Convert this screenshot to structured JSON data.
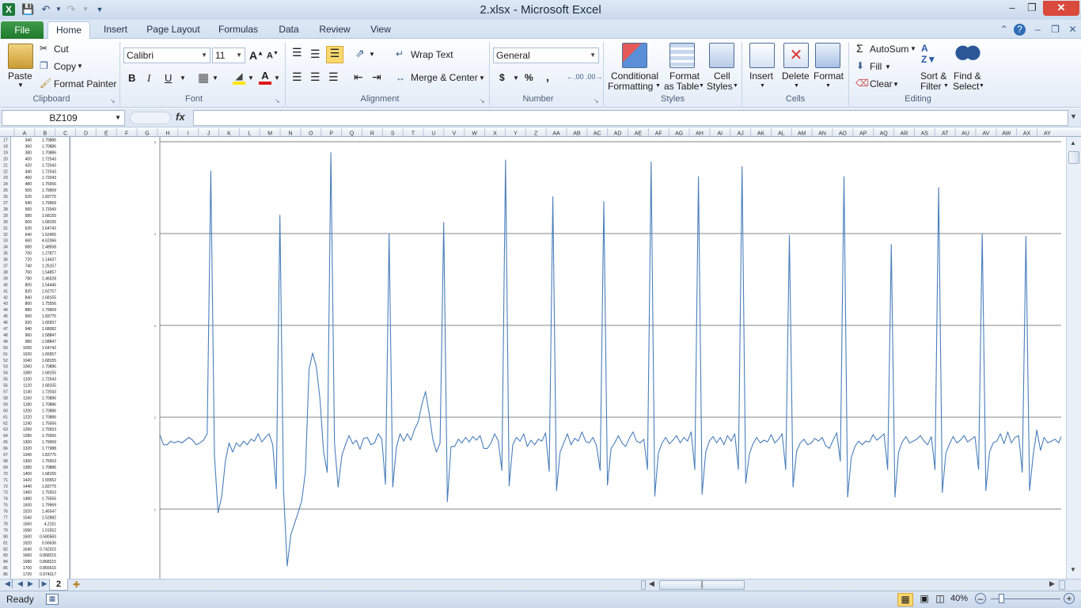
{
  "title_bar": {
    "title": "2.xlsx - Microsoft Excel"
  },
  "tabs": [
    "File",
    "Home",
    "Insert",
    "Page Layout",
    "Formulas",
    "Data",
    "Review",
    "View"
  ],
  "active_tab": "Home",
  "ribbon": {
    "clipboard": {
      "label": "Clipboard",
      "paste": "Paste",
      "cut": "Cut",
      "copy": "Copy",
      "format_painter": "Format Painter"
    },
    "font": {
      "label": "Font",
      "name": "Calibri",
      "size": "11"
    },
    "alignment": {
      "label": "Alignment",
      "wrap": "Wrap Text",
      "merge": "Merge & Center"
    },
    "number": {
      "label": "Number",
      "format": "General"
    },
    "styles": {
      "label": "Styles",
      "cond_1": "Conditional",
      "cond_2": "Formatting",
      "table_1": "Format",
      "table_2": "as Table",
      "cell_1": "Cell",
      "cell_2": "Styles"
    },
    "cells": {
      "label": "Cells",
      "insert": "Insert",
      "delete": "Delete",
      "format": "Format"
    },
    "editing": {
      "label": "Editing",
      "autosum": "AutoSum",
      "fill": "Fill",
      "clear": "Clear",
      "sort_1": "Sort &",
      "sort_2": "Filter",
      "find_1": "Find &",
      "find_2": "Select"
    }
  },
  "formula_bar": {
    "name_box": "BZ109",
    "fx": "fx",
    "formula": ""
  },
  "columns": [
    "A",
    "B",
    "C",
    "D",
    "E",
    "F",
    "G",
    "H",
    "I",
    "J",
    "K",
    "L",
    "M",
    "N",
    "O",
    "P",
    "Q",
    "R",
    "S",
    "T",
    "U",
    "V",
    "W",
    "X",
    "Y",
    "Z",
    "AA",
    "AB",
    "AC",
    "AD",
    "AE",
    "AF",
    "AG",
    "AH",
    "AI",
    "AJ",
    "AK",
    "AL",
    "AM",
    "AN",
    "AO",
    "AP",
    "AQ",
    "AR",
    "AS",
    "AT",
    "AU",
    "AV",
    "AW",
    "AX",
    "AY"
  ],
  "rows": [
    [
      "17",
      "340",
      "1.70886"
    ],
    [
      "18",
      "360",
      "1.70886"
    ],
    [
      "19",
      "380",
      "1.70886"
    ],
    [
      "20",
      "400",
      "1.72043"
    ],
    [
      "21",
      "420",
      "1.72043"
    ],
    [
      "22",
      "440",
      "1.72043"
    ],
    [
      "23",
      "460",
      "1.72043"
    ],
    [
      "24",
      "480",
      "1.75556"
    ],
    [
      "25",
      "500",
      "1.79969"
    ],
    [
      "26",
      "520",
      "1.83775"
    ],
    [
      "27",
      "540",
      "1.79969"
    ],
    [
      "28",
      "560",
      "1.72043"
    ],
    [
      "29",
      "580",
      "1.68155"
    ],
    [
      "30",
      "600",
      "1.68155"
    ],
    [
      "31",
      "620",
      "1.64742"
    ],
    [
      "32",
      "640",
      "1.52455"
    ],
    [
      "33",
      "660",
      "4.62366"
    ],
    [
      "34",
      "680",
      "2.48558"
    ],
    [
      "35",
      "700",
      "1.27877"
    ],
    [
      "36",
      "720",
      "1.14437"
    ],
    [
      "37",
      "740",
      "1.25157"
    ],
    [
      "38",
      "760",
      "1.54857"
    ],
    [
      "39",
      "780",
      "1.46528"
    ],
    [
      "40",
      "800",
      "1.54446"
    ],
    [
      "41",
      "820",
      "1.62757"
    ],
    [
      "42",
      "840",
      "1.68155"
    ],
    [
      "43",
      "860",
      "1.75556"
    ],
    [
      "44",
      "880",
      "1.79969"
    ],
    [
      "45",
      "900",
      "1.83775"
    ],
    [
      "46",
      "920",
      "1.65557"
    ],
    [
      "47",
      "940",
      "1.68082"
    ],
    [
      "48",
      "960",
      "1.58847"
    ],
    [
      "49",
      "980",
      "1.58847"
    ],
    [
      "50",
      "1000",
      "1.64742"
    ],
    [
      "51",
      "1020",
      "1.65557"
    ],
    [
      "52",
      "1040",
      "1.68155"
    ],
    [
      "53",
      "1060",
      "1.70886"
    ],
    [
      "54",
      "1080",
      "1.68155"
    ],
    [
      "55",
      "1100",
      "1.72043"
    ],
    [
      "56",
      "1120",
      "1.68155"
    ],
    [
      "57",
      "1140",
      "1.72043"
    ],
    [
      "58",
      "1160",
      "1.70886"
    ],
    [
      "59",
      "1180",
      "1.70886"
    ],
    [
      "60",
      "1200",
      "1.70886"
    ],
    [
      "61",
      "1220",
      "1.70886"
    ],
    [
      "62",
      "1240",
      "1.75556"
    ],
    [
      "63",
      "1260",
      "1.75553"
    ],
    [
      "64",
      "1280",
      "1.75556"
    ],
    [
      "65",
      "1300",
      "1.79969"
    ],
    [
      "66",
      "1320",
      "1.77988"
    ],
    [
      "67",
      "1340",
      "1.83775"
    ],
    [
      "68",
      "1360",
      "1.75553"
    ],
    [
      "69",
      "1380",
      "1.70886"
    ],
    [
      "70",
      "1400",
      "1.68155"
    ],
    [
      "71",
      "1420",
      "1.55552"
    ],
    [
      "72",
      "1440",
      "1.83775"
    ],
    [
      "73",
      "1460",
      "1.75553"
    ],
    [
      "74",
      "1480",
      "1.75556"
    ],
    [
      "75",
      "1500",
      "1.79969"
    ],
    [
      "76",
      "1520",
      "1.45547"
    ],
    [
      "77",
      "1540",
      "1.52882"
    ],
    [
      "78",
      "1560",
      "4.2151"
    ],
    [
      "79",
      "1580",
      "1.01552"
    ],
    [
      "80",
      "1600",
      "0.580583"
    ],
    [
      "81",
      "1620",
      "0.56636"
    ],
    [
      "82",
      "1640",
      "0.742315"
    ],
    [
      "83",
      "1660",
      "0.868215"
    ],
    [
      "84",
      "1680",
      "0.868215"
    ],
    [
      "85",
      "1700",
      "0.855516"
    ],
    [
      "86",
      "1720",
      "0.974317"
    ]
  ],
  "chart_data": {
    "type": "line",
    "ylim": [
      0,
      5
    ],
    "yticks": [
      "0",
      "1",
      "2",
      "3",
      "4",
      "5"
    ],
    "grid": true,
    "series": [
      {
        "values": [
          1.81,
          1.7,
          1.7,
          1.74,
          1.72,
          1.74,
          1.72,
          1.75,
          1.78,
          1.75,
          1.7,
          1.72,
          1.75,
          1.82,
          4.68,
          1.58,
          0.96,
          1.14,
          1.52,
          1.72,
          1.62,
          1.72,
          1.68,
          1.74,
          1.7,
          1.76,
          1.74,
          1.82,
          1.73,
          1.78,
          1.82,
          1.7,
          1.22,
          4.2,
          1.2,
          0.38,
          0.72,
          0.84,
          0.96,
          1.09,
          1.4,
          2.52,
          2.7,
          2.55,
          2.2,
          1.62,
          1.4,
          4.88,
          1.72,
          1.24,
          1.58,
          1.7,
          1.8,
          1.71,
          1.75,
          1.65,
          1.77,
          1.78,
          1.7,
          1.72,
          1.82,
          1.76,
          1.27,
          4.0,
          1.24,
          1.67,
          1.82,
          1.74,
          1.82,
          1.75,
          1.87,
          1.95,
          2.14,
          2.28,
          2.04,
          1.76,
          1.62,
          1.72,
          4.12,
          1.08,
          1.68,
          1.68,
          1.76,
          1.72,
          1.78,
          1.73,
          1.79,
          1.75,
          1.8,
          1.66,
          1.66,
          1.72,
          1.82,
          1.74,
          1.42,
          4.8,
          1.25,
          1.7,
          1.78,
          1.74,
          1.82,
          1.68,
          1.75,
          1.7,
          1.76,
          1.74,
          1.83,
          1.41,
          4.4,
          1.2,
          1.62,
          1.72,
          1.82,
          1.7,
          1.77,
          1.74,
          1.84,
          1.74,
          1.72,
          1.78,
          1.69,
          1.42,
          4.35,
          1.26,
          1.66,
          1.72,
          1.8,
          1.72,
          1.68,
          1.77,
          1.84,
          1.74,
          1.72,
          1.76,
          1.43,
          4.78,
          1.14,
          1.61,
          1.72,
          1.78,
          1.71,
          1.75,
          1.8,
          1.72,
          1.78,
          1.74,
          1.84,
          1.43,
          4.62,
          1.16,
          1.62,
          1.74,
          1.79,
          1.72,
          1.78,
          1.7,
          1.8,
          1.74,
          1.82,
          1.43,
          4.73,
          1.28,
          1.6,
          1.71,
          1.78,
          1.72,
          1.75,
          1.73,
          1.81,
          1.72,
          1.76,
          1.82,
          1.43,
          3.98,
          1.24,
          1.63,
          1.72,
          1.76,
          1.7,
          1.72,
          1.77,
          1.74,
          1.78,
          1.69,
          1.66,
          1.75,
          1.83,
          1.52,
          4.62,
          1.13,
          1.56,
          1.68,
          1.74,
          1.7,
          1.74,
          1.73,
          1.81,
          1.75,
          1.78,
          1.82,
          1.43,
          3.88,
          1.13,
          1.62,
          1.73,
          1.79,
          1.72,
          1.74,
          1.76,
          1.8,
          1.74,
          1.7,
          1.79,
          1.43,
          4.5,
          1.18,
          1.61,
          1.71,
          1.79,
          1.72,
          1.75,
          1.8,
          1.73,
          1.76,
          1.79,
          1.43,
          4.0,
          1.2,
          1.62,
          1.72,
          1.74,
          1.82,
          1.71,
          1.84,
          1.72,
          1.78,
          1.8,
          1.4,
          3.97,
          1.2,
          1.59,
          1.86,
          1.64,
          1.78,
          1.72,
          1.74,
          1.76,
          1.72,
          1.82,
          1.74
        ]
      }
    ]
  },
  "sheet_tab": "2",
  "status": {
    "ready": "Ready",
    "zoom": "40%"
  }
}
